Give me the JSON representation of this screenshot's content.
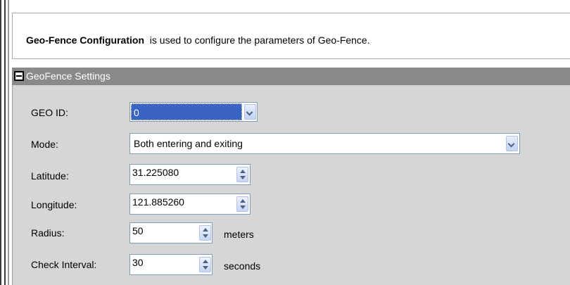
{
  "description": {
    "bold": "Geo-Fence Configuration",
    "text": "  is used to configure the parameters of Geo-Fence."
  },
  "panel": {
    "title": "GeoFence Settings"
  },
  "fields": {
    "geo_id": {
      "label": "GEO ID:",
      "value": "0"
    },
    "mode": {
      "label": "Mode:",
      "value": "Both entering and exiting"
    },
    "latitude": {
      "label": "Latitude:",
      "value": "31.225080"
    },
    "longitude": {
      "label": "Longitude:",
      "value": "121.885260"
    },
    "radius": {
      "label": "Radius:",
      "value": "50",
      "unit": "meters"
    },
    "check_interval": {
      "label": "Check Interval:",
      "value": "30",
      "unit": "seconds"
    }
  },
  "colors": {
    "panel_header": "#8a8a8a",
    "panel_body": "#d6d6d6",
    "selection": "#3b63c3"
  }
}
